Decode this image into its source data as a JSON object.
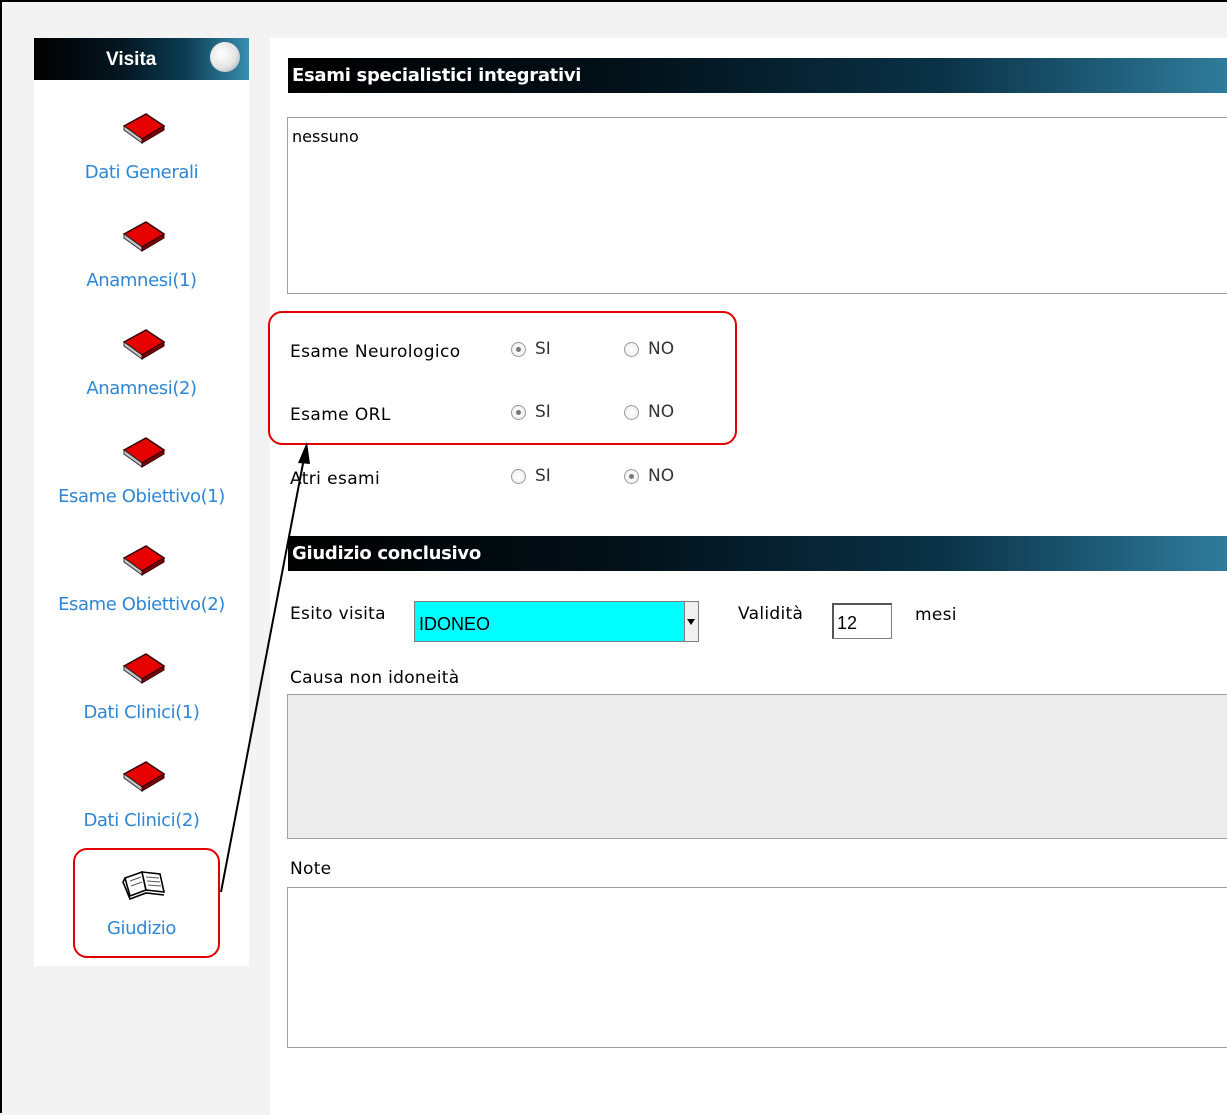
{
  "sidebar": {
    "title": "Visita",
    "items": [
      {
        "label": "Dati Generali",
        "icon": "closed-book-icon"
      },
      {
        "label": "Anamnesi(1)",
        "icon": "closed-book-icon"
      },
      {
        "label": "Anamnesi(2)",
        "icon": "closed-book-icon"
      },
      {
        "label": "Esame Obiettivo(1)",
        "icon": "closed-book-icon"
      },
      {
        "label": "Esame Obiettivo(2)",
        "icon": "closed-book-icon"
      },
      {
        "label": "Dati Clinici(1)",
        "icon": "closed-book-icon"
      },
      {
        "label": "Dati Clinici(2)",
        "icon": "closed-book-icon"
      },
      {
        "label": "Giudizio",
        "icon": "open-book-icon",
        "selected": true
      }
    ]
  },
  "esami": {
    "header": "Esami specialistici integrativi",
    "text": "nessuno",
    "rows": [
      {
        "label": "Esame Neurologico",
        "si": "SI",
        "no": "NO",
        "selected": "SI"
      },
      {
        "label": "Esame ORL",
        "si": "SI",
        "no": "NO",
        "selected": "SI"
      },
      {
        "label": "Atri esami",
        "si": "SI",
        "no": "NO",
        "selected": "NO"
      }
    ]
  },
  "giudizio": {
    "header": "Giudizio conclusivo",
    "esito_label": "Esito visita",
    "esito_value": "IDONEO",
    "validita_label": "Validità",
    "validita_value": "12",
    "validita_unit": "mesi",
    "causa_label": "Causa non idoneità",
    "note_label": "Note"
  },
  "colors": {
    "annotation": "#e00000",
    "esito_background": "#00ffff",
    "link": "#2e86d6"
  }
}
